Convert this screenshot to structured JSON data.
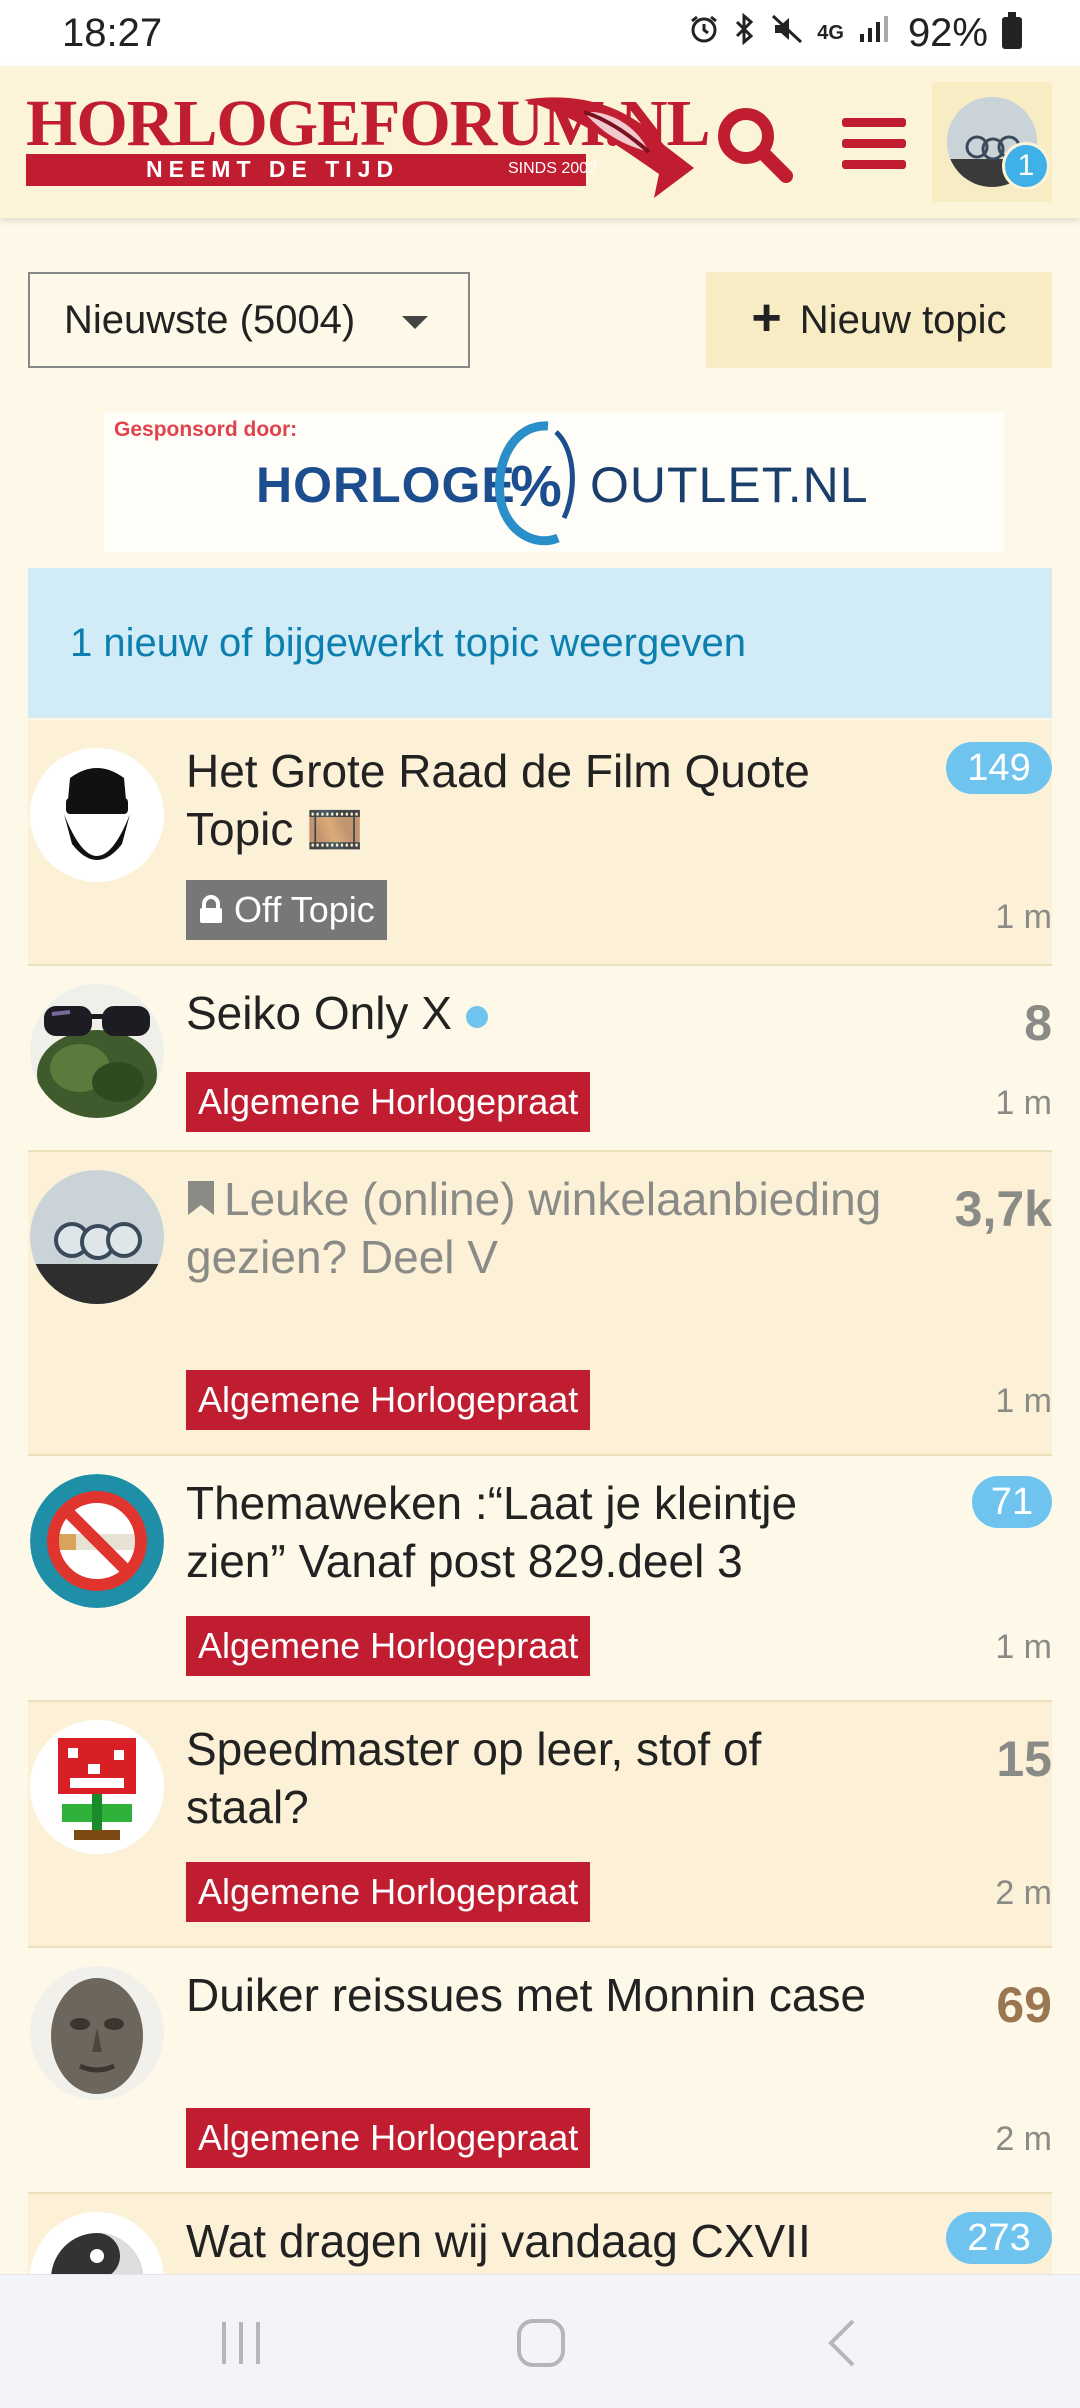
{
  "status": {
    "time": "18:27",
    "network": "4G",
    "battery": "92%"
  },
  "header": {
    "logo_title": "HORLOGEFORUM.NL",
    "logo_tagline": "NEEMT DE TIJD",
    "logo_since": "SINDS 2002",
    "notification_count": "1"
  },
  "controls": {
    "filter_label": "Nieuwste (5004)",
    "new_topic_label": "Nieuw topic"
  },
  "sponsor": {
    "label": "Gesponsord door:",
    "brand_left": "HORLOGE",
    "brand_mark": "%",
    "brand_right": "OUTLET.NL"
  },
  "banner": {
    "text": "1 nieuw of bijgewerkt topic weergeven"
  },
  "topics": [
    {
      "title": "Het Grote Raad de Film Quote Topic 🎞️",
      "category": "Off Topic",
      "count": "149",
      "time": "1 m"
    },
    {
      "title": "Seiko Only X",
      "category": "Algemene Horlogepraat",
      "count": "8",
      "time": "1 m"
    },
    {
      "title": "Leuke (online) winkelaanbieding gezien? Deel V",
      "category": "Algemene Horlogepraat",
      "count": "3,7k",
      "time": "1 m"
    },
    {
      "title": "Themaweken :“Laat je kleintje zien” Vanaf post 829.deel 3",
      "category": "Algemene Horlogepraat",
      "count": "71",
      "time": "1 m"
    },
    {
      "title": "Speedmaster op leer, stof of staal?",
      "category": "Algemene Horlogepraat",
      "count": "15",
      "time": "2 m"
    },
    {
      "title": "Duiker reissues met Monnin case",
      "category": "Algemene Horlogepraat",
      "count": "69",
      "time": "2 m"
    },
    {
      "title": "Wat dragen wij vandaag CXVII",
      "count": "273"
    }
  ],
  "colors": {
    "brand_red": "#c01d30",
    "page_bg": "#fdf8e7",
    "row_alt_bg": "#fcf1d6",
    "new_badge_blue": "#6ec4ef",
    "banner_bg": "#d1ecf7"
  },
  "icons": {
    "search": "search-icon",
    "menu": "hamburger-icon",
    "lock": "lock-icon",
    "bookmark": "bookmark-icon",
    "plus": "plus-icon",
    "nav_recents": "recent-apps-icon",
    "nav_home": "home-icon",
    "nav_back": "back-icon"
  }
}
